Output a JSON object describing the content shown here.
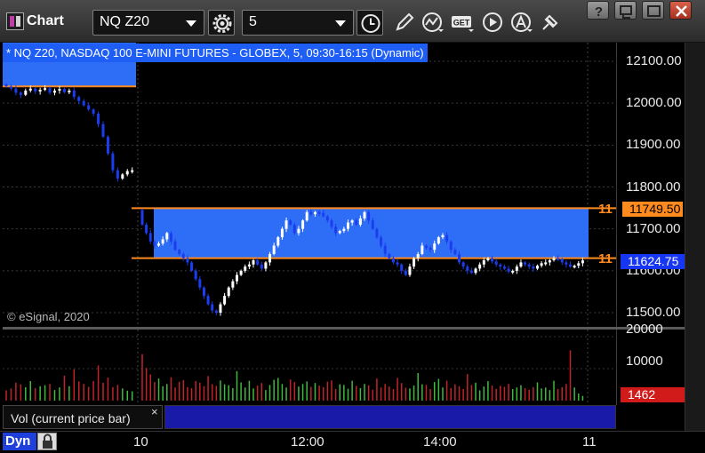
{
  "app": {
    "title": "Chart",
    "accent": "#c03ca8"
  },
  "toolbar": {
    "symbol": "NQ Z20",
    "interval": "5",
    "icons": [
      "settings-gear-icon",
      "clock-icon",
      "pencil-icon",
      "study-icon",
      "get-icon",
      "play-icon",
      "alert-icon",
      "pin-icon"
    ],
    "window_buttons": [
      "help",
      "restore",
      "maximize",
      "close"
    ],
    "help_label": "?"
  },
  "chart": {
    "title": "* NQ Z20, NASDAQ 100 E-MINI FUTURES - GLOBEX, 5, 09:30-16:15 (Dynamic)",
    "copyright": "© eSignal, 2020",
    "upper_level": "11749.50",
    "last_price": "11624.75",
    "upper_edge_label": "11",
    "lower_edge_label": "11",
    "zone_color": "#2e6ef6",
    "level_color": "#ff8b1f",
    "up_color": "#ffffff",
    "down_color": "#1b3df0"
  },
  "price_axis": {
    "ticks": [
      "12100.00",
      "12000.00",
      "11900.00",
      "11800.00",
      "11700.00",
      "11600.00",
      "11500.00"
    ]
  },
  "volume": {
    "label": "Vol (current price bar)",
    "close_label": "×",
    "last": "1462",
    "ticks": [
      "20000",
      "10000"
    ],
    "up_color": "#3fb93f",
    "down_color": "#c0242a"
  },
  "time_axis": {
    "labels": [
      "10",
      "12:00",
      "14:00",
      "11"
    ]
  },
  "footer": {
    "mode": "Dyn"
  },
  "chart_data": {
    "type": "candlestick",
    "title": "* NQ Z20, NASDAQ 100 E-MINI FUTURES - GLOBEX, 5, 09:30-16:15 (Dynamic)",
    "ylim": [
      11470,
      12130
    ],
    "y_ticks": [
      12100,
      12000,
      11900,
      11800,
      11700,
      11600,
      11500
    ],
    "x_labels": [
      "10",
      "12:00",
      "14:00",
      "11"
    ],
    "levels": [
      {
        "price": 12040,
        "range": "prior-session"
      },
      {
        "price": 11749.5,
        "label": "11749.50"
      },
      {
        "price": 11630
      }
    ],
    "last_price": 11624.75,
    "session1_close": [
      12040,
      12035,
      12025,
      12020,
      12030,
      12035,
      12028,
      12032,
      12036,
      12025,
      12030,
      12034,
      12026,
      12030,
      12015,
      12005,
      11995,
      11985,
      11975,
      11950,
      11920,
      11880,
      11840,
      11820,
      11830,
      11838,
      11840
    ],
    "session2_close": [
      11710,
      11690,
      11670,
      11660,
      11665,
      11675,
      11690,
      11670,
      11650,
      11640,
      11630,
      11620,
      11600,
      11580,
      11560,
      11540,
      11520,
      11505,
      11500,
      11520,
      11540,
      11560,
      11575,
      11590,
      11600,
      11610,
      11615,
      11625,
      11615,
      11605,
      11620,
      11640,
      11660,
      11680,
      11700,
      11720,
      11710,
      11690,
      11700,
      11720,
      11740,
      11735,
      11740,
      11738,
      11730,
      11720,
      11705,
      11690,
      11695,
      11700,
      11715,
      11720,
      11710,
      11725,
      11740,
      11720,
      11700,
      11680,
      11660,
      11640,
      11630,
      11620,
      11615,
      11600,
      11590,
      11610,
      11630,
      11640,
      11660,
      11655,
      11650,
      11665,
      11680,
      11685,
      11670,
      11650,
      11640,
      11620,
      11610,
      11600,
      11595,
      11605,
      11615,
      11625,
      11630,
      11622,
      11615,
      11610,
      11605,
      11598,
      11600,
      11610,
      11620,
      11615,
      11610,
      11605,
      11612,
      11618,
      11620,
      11625,
      11630,
      11628,
      11620,
      11615,
      11610,
      11612,
      11618,
      11624.75
    ],
    "volume_ylim": [
      0,
      20000
    ],
    "volume_session1": [
      3200,
      3800,
      5600,
      5100,
      4200,
      6100,
      3900,
      4500,
      4800,
      5200,
      3300,
      4100,
      7800,
      4500,
      9800,
      6000,
      5200,
      4300,
      6100,
      11000,
      5600,
      7200,
      4200,
      4900,
      3800,
      3100,
      2900
    ],
    "volume_session2": [
      14500,
      10200,
      8200,
      5800,
      6900,
      4500,
      5200,
      7300,
      4100,
      5900,
      6400,
      4200,
      3900,
      6100,
      5600,
      4500,
      7700,
      5100,
      4600,
      6300,
      5100,
      4800,
      3900,
      9200,
      5700,
      4100,
      6200,
      3800,
      4700,
      5500,
      3300,
      4900,
      6500,
      7100,
      5200,
      4100,
      6600,
      5800,
      4400,
      5200,
      6000,
      4300,
      5500,
      4700,
      4200,
      5900,
      6300,
      3600,
      5100,
      4900,
      3700,
      6200,
      4600,
      3900,
      5200,
      4800,
      3400,
      6900,
      4100,
      5200,
      4400,
      3600,
      7100,
      5500,
      4000,
      3800,
      4700,
      8600,
      5100,
      4900,
      3600,
      5800,
      6800,
      4100,
      6200,
      3900,
      5100,
      4500,
      3600,
      8300,
      4900,
      5600,
      3200,
      4400,
      6100,
      4700,
      3700,
      4600,
      4300,
      5200,
      3600,
      4100,
      4800,
      3900,
      3400,
      4200,
      5700,
      3800,
      4100,
      3300,
      6200,
      3600,
      4200,
      5200,
      15700,
      4100,
      2200,
      1462
    ]
  }
}
